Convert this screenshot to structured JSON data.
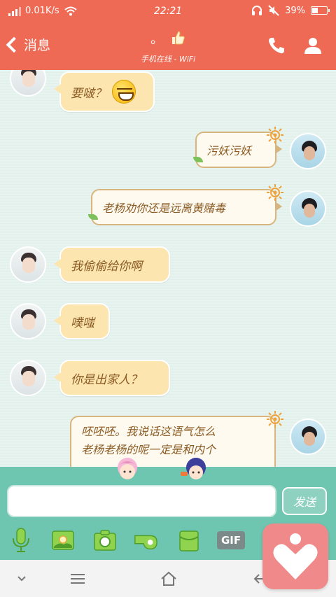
{
  "status": {
    "network_speed": "0.01K/s",
    "time": "22:21",
    "battery": "39%",
    "battery_level": 0.39
  },
  "header": {
    "back_label": "消息",
    "title": "。",
    "subtitle": "手机在线 - WiFi"
  },
  "messages": [
    {
      "side": "left",
      "text": "要啵？",
      "emoji": "grinning-face"
    },
    {
      "side": "right",
      "text": "污妖污妖"
    },
    {
      "side": "right",
      "text": "老杨劝你还是远离黄赌毒"
    },
    {
      "side": "left",
      "text": "我偷偷给你啊"
    },
    {
      "side": "left",
      "text": "噗嗤"
    },
    {
      "side": "left",
      "text": "你是出家人？"
    },
    {
      "side": "right",
      "text": "呸呸呸。我说话这语气怎么",
      "text2": "老杨老杨的呢一定是和内个"
    }
  ],
  "input": {
    "placeholder": "",
    "send_label": "发送"
  },
  "toolbar": {
    "items": [
      "voice-icon",
      "picture-icon",
      "camera-icon",
      "red-packet-icon",
      "gift-icon",
      "gif-icon"
    ],
    "gif_label": "GIF"
  },
  "colors": {
    "header": "#ef6a55",
    "input_bg": "#6ec6b0",
    "bubble_left": "#fde5b0",
    "bubble_right": "#fffaef",
    "float_widget": "#f08a8a"
  }
}
